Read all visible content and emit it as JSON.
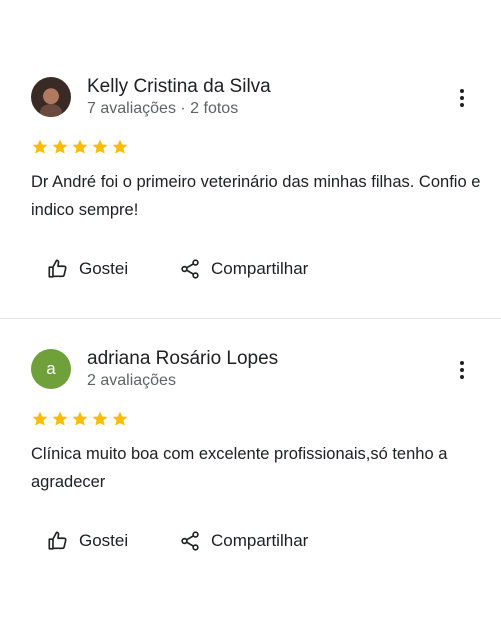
{
  "reviews": [
    {
      "author": "Kelly Cristina da Silva",
      "meta": "7 avaliações · 2 fotos",
      "avatar_type": "photo",
      "avatar_letter": "",
      "rating": 5,
      "text": "Dr André foi o primeiro veterinário das minhas filhas. Confio e indico sempre!",
      "like_label": "Gostei",
      "share_label": "Compartilhar"
    },
    {
      "author": "adriana Rosário Lopes",
      "meta": "2 avaliações",
      "avatar_type": "letter",
      "avatar_letter": "a",
      "avatar_color": "#6fa03a",
      "rating": 5,
      "text": "Clínica muito boa com excelente profissionais,só tenho a agradecer",
      "like_label": "Gostei",
      "share_label": "Compartilhar"
    }
  ],
  "colors": {
    "star": "#fbbc04",
    "text": "#202124",
    "secondary_text": "#5f6368",
    "divider": "#e4e4e4"
  },
  "icons": [
    "more-vert-icon",
    "star-icon",
    "thumb-up-icon",
    "share-icon"
  ]
}
